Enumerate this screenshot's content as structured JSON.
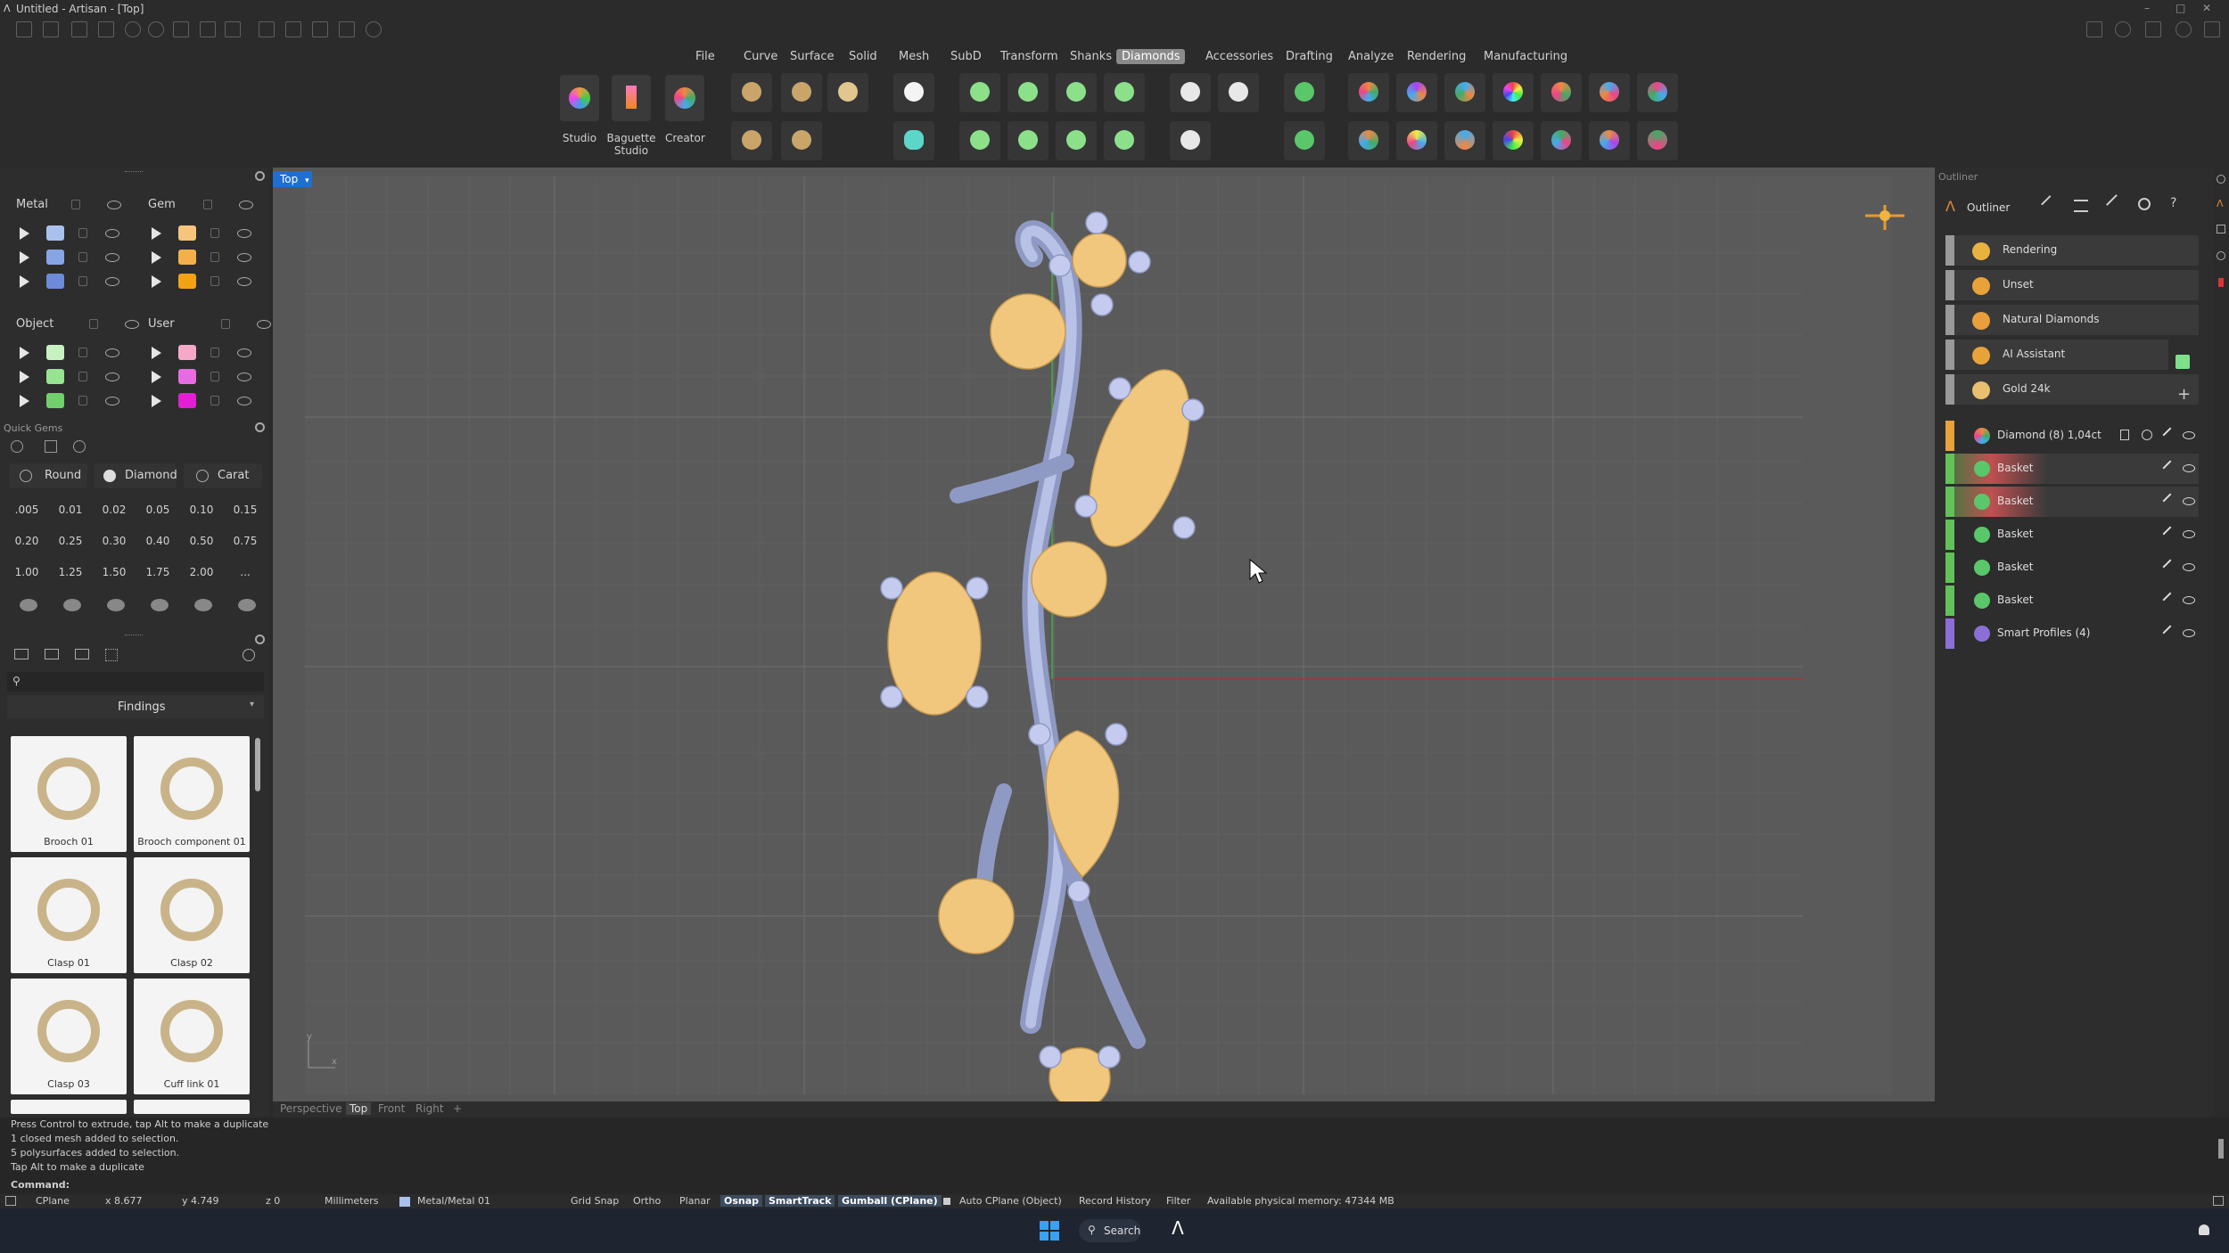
{
  "window": {
    "title": "Untitled - Artisan - [Top]"
  },
  "menu": [
    "File",
    "Curve",
    "Surface",
    "Solid",
    "Mesh",
    "SubD",
    "Transform",
    "Shanks",
    "Diamonds",
    "Accessories",
    "Drafting",
    "Analyze",
    "Rendering",
    "Manufacturing"
  ],
  "menu_active": "Diamonds",
  "ribbon": {
    "studio": "Studio",
    "baguette": "Baguette",
    "baguette2": "Studio",
    "creator": "Creator"
  },
  "layers": {
    "metal": "Metal",
    "gem": "Gem",
    "object": "Object",
    "user": "User",
    "metal_colors": [
      "#a9c1ee",
      "#87a5e6",
      "#6d8bd8"
    ],
    "gem_colors": [
      "#f6c47a",
      "#f3b04a",
      "#f2a213"
    ],
    "object_colors": [
      "#c7f1c0",
      "#98e391",
      "#72cf6d"
    ],
    "user_colors": [
      "#f5a9c8",
      "#e86ce1",
      "#e21fd4"
    ]
  },
  "quick_gems": {
    "header": "Quick Gems",
    "tabs": [
      "Round",
      "Diamond",
      "Carat"
    ],
    "sizes": [
      ".005",
      "0.01",
      "0.02",
      "0.05",
      "0.10",
      "0.15",
      "0.20",
      "0.25",
      "0.30",
      "0.40",
      "0.50",
      "0.75",
      "1.00",
      "1.25",
      "1.50",
      "1.75",
      "2.00",
      "..."
    ]
  },
  "library": {
    "category": "Findings",
    "items": [
      "Brooch 01",
      "Brooch component 01",
      "Clasp 01",
      "Clasp 02",
      "Clasp 03",
      "Cuff link 01"
    ]
  },
  "viewport": {
    "name": "Top",
    "tabs": [
      "Perspective",
      "Top",
      "Front",
      "Right",
      "+"
    ],
    "active_tab": "Top"
  },
  "outliner": {
    "header": "Outliner",
    "section_label": "Outliner",
    "panels": [
      "Rendering",
      "Unset",
      "Natural Diamonds",
      "AI Assistant",
      "Gold 24k"
    ],
    "tree": [
      {
        "label": "Diamond (8) 1,04ct",
        "color": "#e8a23a"
      },
      {
        "label": "Basket",
        "color": "#62c25a"
      },
      {
        "label": "Basket",
        "color": "#62c25a"
      },
      {
        "label": "Basket",
        "color": "#62c25a"
      },
      {
        "label": "Basket",
        "color": "#62c25a"
      },
      {
        "label": "Basket",
        "color": "#62c25a"
      },
      {
        "label": "Smart Profiles (4)",
        "color": "#8c6fd6"
      }
    ]
  },
  "command": {
    "history": [
      "Press Control to extrude, tap Alt to make a duplicate",
      "1 closed mesh added to selection.",
      "5 polysurfaces added to selection.",
      "Tap Alt to make a duplicate"
    ],
    "prompt": "Command:"
  },
  "status": {
    "cplane": "CPlane",
    "x": "x 8.677",
    "y": "y 4.749",
    "z": "z 0",
    "units": "Millimeters",
    "layer": "Metal/Metal 01",
    "grid_snap": "Grid Snap",
    "ortho": "Ortho",
    "planar": "Planar",
    "osnap": "Osnap",
    "smarttrack": "SmartTrack",
    "gumball": "Gumball (CPlane)",
    "auto_cplane": "Auto CPlane (Object)",
    "record_history": "Record History",
    "filter": "Filter",
    "memory": "Available physical memory: 47344 MB"
  },
  "taskbar": {
    "search": "Search"
  }
}
